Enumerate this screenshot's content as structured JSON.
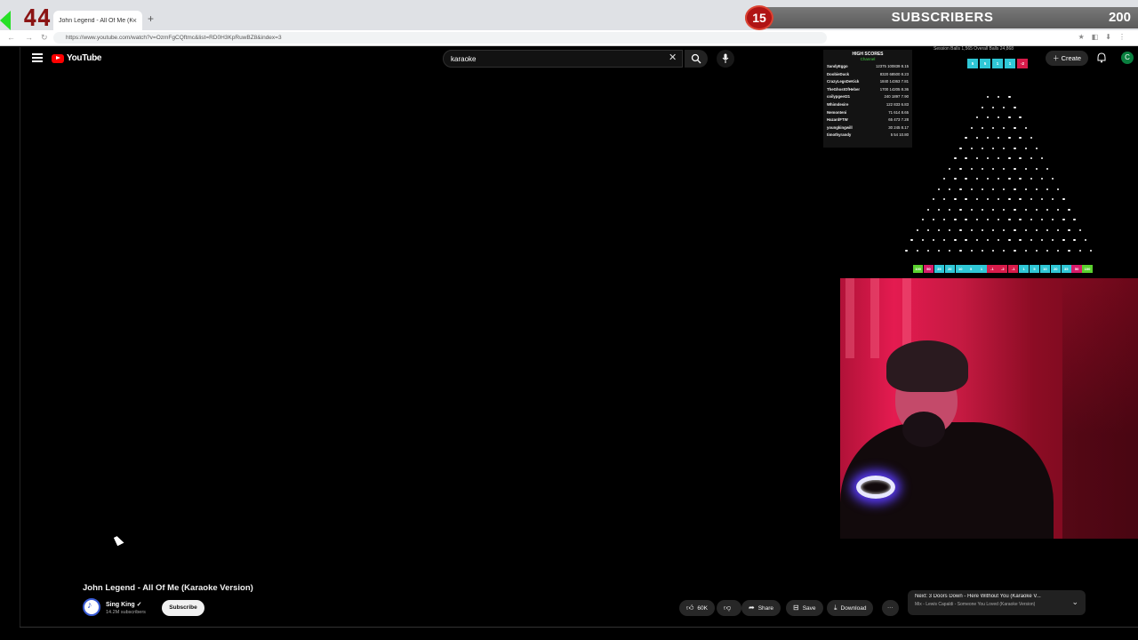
{
  "browser": {
    "tab_title": "John Legend - All Of Me (Kar",
    "tab_close": "×",
    "new_tab": "+",
    "url": "https://www.youtube.com/watch?v=OzmFgCQftmc&list=RD0H3KpRuwBZ8&index=3"
  },
  "overlay": {
    "left_number": "44",
    "sub_count": "15",
    "sub_label": "SUBSCRIBERS",
    "sub_goal": "200",
    "session_balls": "Session Balls  1,565      Overall Balls  24,868",
    "high_scores": {
      "title": "HIGH SCORES",
      "subtitle": "Channel",
      "rows": [
        {
          "name": "SandyEggo",
          "stats": "12375 100839 8.15"
        },
        {
          "name": "DoobieDuck",
          "stats": "8320 68500 8.23"
        },
        {
          "name": "CrazyLegsDeKick",
          "stats": "1840 14363 7.81"
        },
        {
          "name": "TheGhostOfHeber",
          "stats": "1700 14205 8.36"
        },
        {
          "name": "coilypgeet21",
          "stats": "240 1897 7.90"
        },
        {
          "name": "Whimdesire",
          "stats": "122 833 6.83"
        },
        {
          "name": "Nemonteni",
          "stats": "71 614 8.65"
        },
        {
          "name": "HazardFTW",
          "stats": "65 473 7.28"
        },
        {
          "name": "youngkingwill",
          "stats": "30 245 8.17"
        },
        {
          "name": "timothyrandy",
          "stats": "5 54 10.80"
        }
      ]
    },
    "recent_drops": [
      {
        "label": "5",
        "color": "#2fc7d6"
      },
      {
        "label": "5",
        "color": "#2fc7d6"
      },
      {
        "label": "1",
        "color": "#2fc7d6"
      },
      {
        "label": "1",
        "color": "#2fc7d6"
      },
      {
        "label": "-2",
        "color": "#d81b4a"
      }
    ],
    "plinko_slots": [
      {
        "label": "100",
        "color": "#5bd12f"
      },
      {
        "label": "50",
        "color": "#d81b6a"
      },
      {
        "label": "35",
        "color": "#2fc7d6"
      },
      {
        "label": "20",
        "color": "#2fc7d6"
      },
      {
        "label": "10",
        "color": "#2fc7d6"
      },
      {
        "label": "5",
        "color": "#2fc7d6"
      },
      {
        "label": "1",
        "color": "#2fc7d6"
      },
      {
        "label": "-1",
        "color": "#d81b4a"
      },
      {
        "label": "-2",
        "color": "#d81b4a"
      },
      {
        "label": "-1",
        "color": "#d81b4a"
      },
      {
        "label": "1",
        "color": "#2fc7d6"
      },
      {
        "label": "5",
        "color": "#2fc7d6"
      },
      {
        "label": "10",
        "color": "#2fc7d6"
      },
      {
        "label": "20",
        "color": "#2fc7d6"
      },
      {
        "label": "35",
        "color": "#2fc7d6"
      },
      {
        "label": "50",
        "color": "#d81b6a"
      },
      {
        "label": "100",
        "color": "#5bd12f"
      }
    ]
  },
  "youtube": {
    "logo_text": "YouTube",
    "search_value": "karaoke",
    "search_clear": "✕",
    "create_label": "Create",
    "avatar_letter": "C",
    "video_title": "John Legend - All Of Me (Karaoke Version)",
    "channel_name": "Sing King ✓",
    "channel_subs": "14.2M subscribers",
    "subscribe_label": "Subscribe",
    "like_count": "60K",
    "share_label": "Share",
    "save_label": "Save",
    "download_label": "Download",
    "more_label": "···",
    "next_title": "Next: 3 Doors Down - Here Without You (Karaoke V...",
    "next_mix": "Mix - Lewis Capaldi - Someone You Loved (Karaoke Version)",
    "next_chevron": "⌄"
  }
}
